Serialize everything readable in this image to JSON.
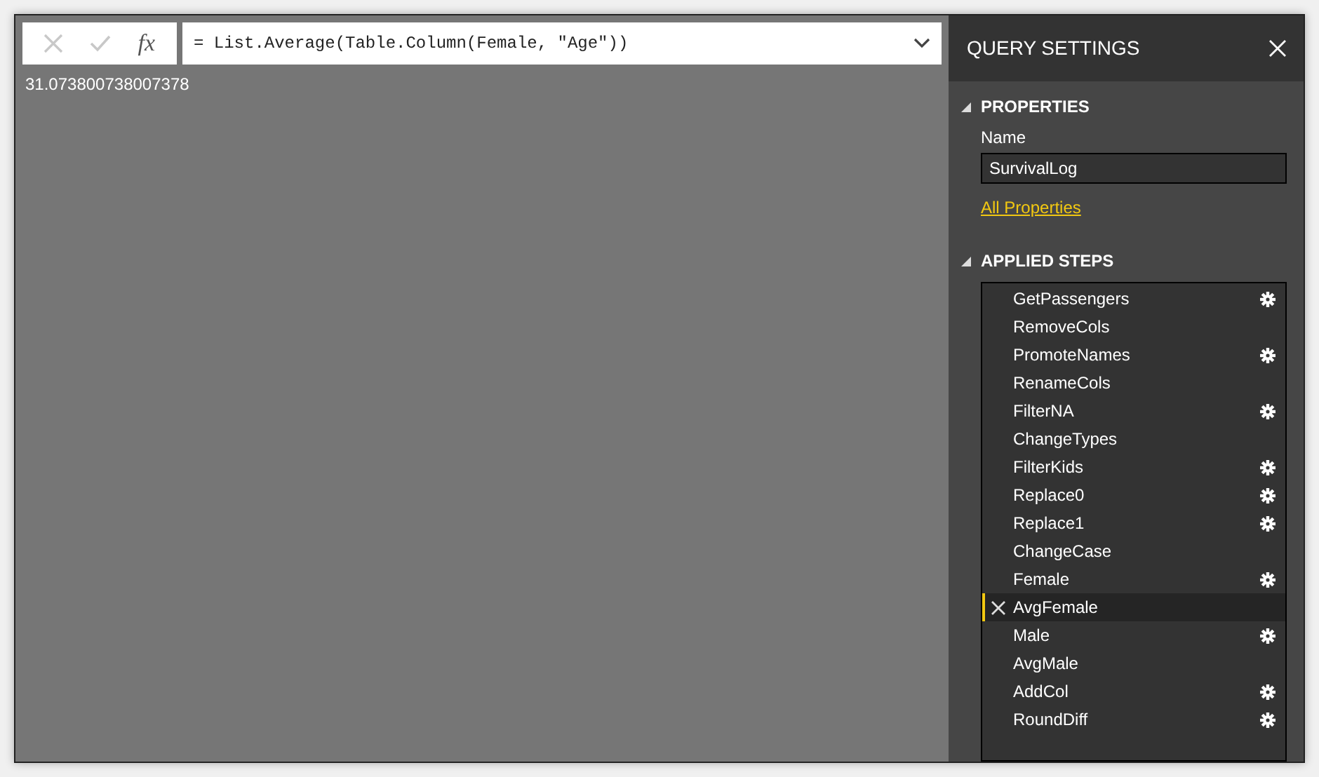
{
  "formula_bar": {
    "formula": "= List.Average(Table.Column(Female, \"Age\"))",
    "fx": "fx"
  },
  "result": "31.073800738007378",
  "query_settings": {
    "title": "QUERY SETTINGS",
    "properties": {
      "heading": "PROPERTIES",
      "name_label": "Name",
      "name_value": "SurvivalLog",
      "link": "All Properties"
    },
    "applied_steps": {
      "heading": "APPLIED STEPS",
      "steps": [
        {
          "label": "GetPassengers",
          "has_settings": true,
          "selected": false
        },
        {
          "label": "RemoveCols",
          "has_settings": false,
          "selected": false
        },
        {
          "label": "PromoteNames",
          "has_settings": true,
          "selected": false
        },
        {
          "label": "RenameCols",
          "has_settings": false,
          "selected": false
        },
        {
          "label": "FilterNA",
          "has_settings": true,
          "selected": false
        },
        {
          "label": "ChangeTypes",
          "has_settings": false,
          "selected": false
        },
        {
          "label": "FilterKids",
          "has_settings": true,
          "selected": false
        },
        {
          "label": "Replace0",
          "has_settings": true,
          "selected": false
        },
        {
          "label": "Replace1",
          "has_settings": true,
          "selected": false
        },
        {
          "label": "ChangeCase",
          "has_settings": false,
          "selected": false
        },
        {
          "label": "Female",
          "has_settings": true,
          "selected": false
        },
        {
          "label": "AvgFemale",
          "has_settings": false,
          "selected": true
        },
        {
          "label": "Male",
          "has_settings": true,
          "selected": false
        },
        {
          "label": "AvgMale",
          "has_settings": false,
          "selected": false
        },
        {
          "label": "AddCol",
          "has_settings": true,
          "selected": false
        },
        {
          "label": "RoundDiff",
          "has_settings": true,
          "selected": false
        }
      ]
    }
  }
}
